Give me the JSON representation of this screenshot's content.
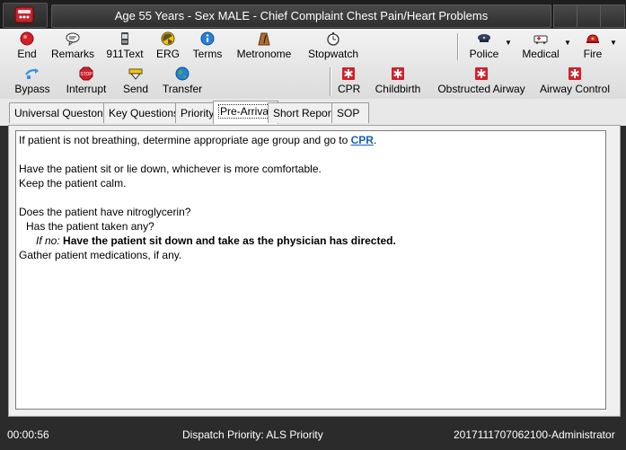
{
  "window": {
    "title": "Age 55 Years - Sex MALE - Chief Complaint Chest Pain/Heart Problems"
  },
  "toolbar1": [
    {
      "label": "End",
      "icon": "red-circle-icon"
    },
    {
      "label": "Remarks",
      "icon": "speech-bubble-icon"
    },
    {
      "label": "911Text",
      "icon": "phone-text-icon"
    },
    {
      "label": "ERG",
      "icon": "hazard-icon"
    },
    {
      "label": "Terms",
      "icon": "info-icon"
    },
    {
      "label": "Metronome",
      "icon": "metronome-icon"
    },
    {
      "label": "Stopwatch",
      "icon": "stopwatch-icon"
    }
  ],
  "services": [
    {
      "label": "Police",
      "icon": "police-hat-icon"
    },
    {
      "label": "Medical",
      "icon": "ambulance-icon"
    },
    {
      "label": "Fire",
      "icon": "fire-helmet-icon"
    }
  ],
  "toolbar2": [
    {
      "label": "Bypass",
      "icon": "bypass-arrow-icon"
    },
    {
      "label": "Interrupt",
      "icon": "stop-sign-icon"
    },
    {
      "label": "Send",
      "icon": "send-icon"
    },
    {
      "label": "Transfer",
      "icon": "globe-icon"
    }
  ],
  "protocols": [
    {
      "label": "CPR",
      "icon": "medical-star-icon"
    },
    {
      "label": "Childbirth",
      "icon": "medical-star-icon"
    },
    {
      "label": "Obstructed Airway",
      "icon": "medical-star-icon"
    },
    {
      "label": "Airway Control",
      "icon": "medical-star-icon"
    }
  ],
  "tabs": [
    {
      "label": "Universal Questons"
    },
    {
      "label": "Key Questions"
    },
    {
      "label": "Priority"
    },
    {
      "label": "Pre-Arrival"
    },
    {
      "label": "Short Report"
    },
    {
      "label": "SOP"
    }
  ],
  "content": {
    "line1_pre": "If patient is not breathing, determine appropriate age group and go to ",
    "line1_link": "CPR",
    "line1_post": ".",
    "line2": "Have the patient sit or lie down, whichever is more comfortable.",
    "line3": "Keep the patient calm.",
    "line4": "Does the patient have nitroglycerin?",
    "line5": "Has the patient taken any?",
    "line6_cond": "If no:",
    "line6_text": "Have the patient sit down and take as the physician has directed.",
    "line7": "Gather patient medications, if any."
  },
  "status": {
    "timer": "00:00:56",
    "priority": "Dispatch Priority: ALS Priority",
    "case": "20171117070621​00-Administrator"
  },
  "colors": {
    "link": "#1a5fb4",
    "dark_chrome": "#2b2b2b"
  }
}
